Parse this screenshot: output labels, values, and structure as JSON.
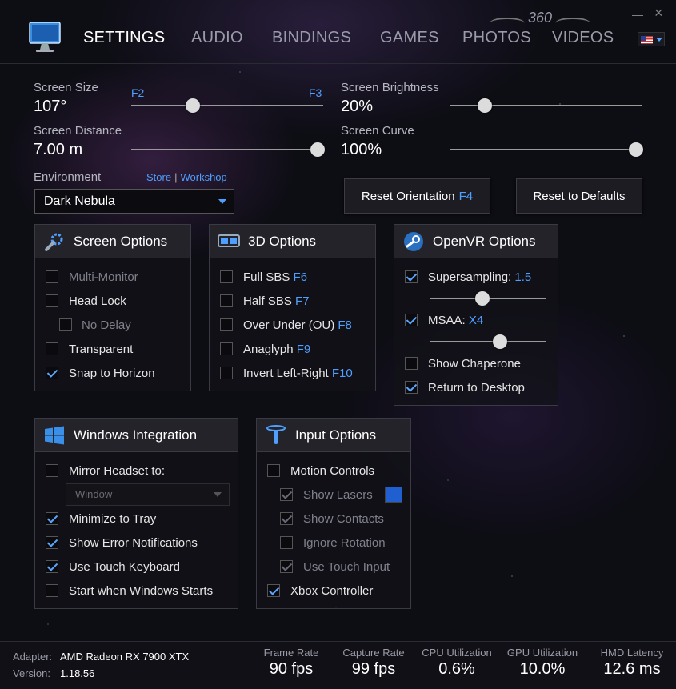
{
  "nav": {
    "tabs": [
      "SETTINGS",
      "AUDIO",
      "BINDINGS",
      "GAMES",
      "PHOTOS",
      "VIDEOS"
    ],
    "badge_360": "360",
    "language_icon": "us-flag-icon"
  },
  "window": {
    "minimize": "—",
    "close": "×"
  },
  "sliders": {
    "size": {
      "label": "Screen Size",
      "value": "107°",
      "key_left": "F2",
      "key_right": "F3",
      "level": 0.32
    },
    "distance": {
      "label": "Screen Distance",
      "value": "7.00 m",
      "level": 1.0
    },
    "brightness": {
      "label": "Screen Brightness",
      "value": "20%",
      "level": 0.18
    },
    "curve": {
      "label": "Screen Curve",
      "value": "100%",
      "level": 1.0
    }
  },
  "environment": {
    "label": "Environment",
    "store": "Store",
    "separator": "|",
    "workshop": "Workshop",
    "selected": "Dark Nebula"
  },
  "buttons": {
    "reset_orientation": "Reset Orientation",
    "reset_orientation_key": "F4",
    "reset_defaults": "Reset to Defaults"
  },
  "screen_options": {
    "title": "Screen Options",
    "items": [
      {
        "label": "Multi-Monitor",
        "checked": false,
        "disabled": true
      },
      {
        "label": "Head Lock",
        "checked": false,
        "disabled": false
      },
      {
        "label": "No Delay",
        "checked": false,
        "disabled": true
      },
      {
        "label": "Transparent",
        "checked": false,
        "disabled": false
      },
      {
        "label": "Snap to Horizon",
        "checked": true,
        "disabled": false
      }
    ]
  },
  "options_3d": {
    "title": "3D Options",
    "items": [
      {
        "label": "Full SBS",
        "key": "F6",
        "checked": false
      },
      {
        "label": "Half SBS",
        "key": "F7",
        "checked": false
      },
      {
        "label": "Over Under (OU)",
        "key": "F8",
        "checked": false
      },
      {
        "label": "Anaglyph",
        "key": "F9",
        "checked": false
      },
      {
        "label": "Invert Left-Right",
        "key": "F10",
        "checked": false
      }
    ]
  },
  "openvr": {
    "title": "OpenVR Options",
    "supersampling": {
      "label": "Supersampling:",
      "value": "1.5",
      "checked": true,
      "level": 0.45
    },
    "msaa": {
      "label": "MSAA:",
      "value": "X4",
      "checked": true,
      "level": 0.6
    },
    "chaperone": {
      "label": "Show Chaperone",
      "checked": false
    },
    "return_desktop": {
      "label": "Return to Desktop",
      "checked": true
    }
  },
  "windows_integration": {
    "title": "Windows Integration",
    "mirror": {
      "label": "Mirror Headset to:",
      "checked": false
    },
    "mirror_select": "Window",
    "items": [
      {
        "label": "Minimize to Tray",
        "checked": true
      },
      {
        "label": "Show Error Notifications",
        "checked": true
      },
      {
        "label": "Use Touch Keyboard",
        "checked": true
      },
      {
        "label": "Start when Windows Starts",
        "checked": false
      }
    ]
  },
  "input_options": {
    "title": "Input Options",
    "items": [
      {
        "label": "Motion Controls",
        "checked": false,
        "disabled": false
      },
      {
        "label": "Show Lasers",
        "checked": true,
        "disabled": true
      },
      {
        "label": "Show Contacts",
        "checked": true,
        "disabled": true
      },
      {
        "label": "Ignore Rotation",
        "checked": false,
        "disabled": true
      },
      {
        "label": "Use Touch Input",
        "checked": true,
        "disabled": true
      },
      {
        "label": "Xbox Controller",
        "checked": true,
        "disabled": false
      }
    ],
    "laser_color": "#1f5fd0"
  },
  "status": {
    "adapter_label": "Adapter:",
    "adapter": "AMD Radeon RX 7900 XTX",
    "version_label": "Version:",
    "version": "1.18.56",
    "metrics": [
      {
        "label": "Frame Rate",
        "value": "90 fps"
      },
      {
        "label": "Capture Rate",
        "value": "99 fps"
      },
      {
        "label": "CPU Utilization",
        "value": "0.6%"
      },
      {
        "label": "GPU Utilization",
        "value": "10.0%"
      },
      {
        "label": "HMD Latency",
        "value": "12.6 ms"
      }
    ]
  },
  "colors": {
    "accent": "#4f9fff",
    "panel_head": "#232329",
    "background": "#0d0d14"
  }
}
